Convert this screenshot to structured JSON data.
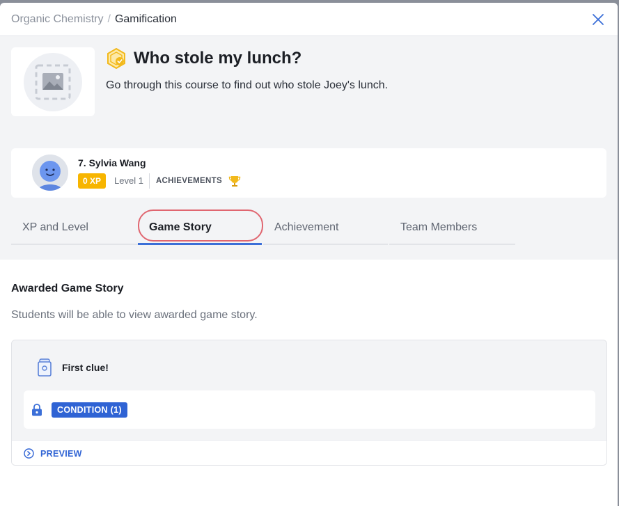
{
  "breadcrumb": {
    "parent": "Organic Chemistry",
    "separator": "/",
    "current": "Gamification"
  },
  "course": {
    "title": "Who stole my lunch?",
    "description": "Go through this course to find out who stole Joey's lunch."
  },
  "student": {
    "name": "7. Sylvia Wang",
    "xp": "0 XP",
    "level": "Level 1",
    "achievements_label": "ACHIEVEMENTS"
  },
  "tabs": [
    {
      "label": "XP and Level"
    },
    {
      "label": "Game Story"
    },
    {
      "label": "Achievement"
    },
    {
      "label": "Team Members"
    }
  ],
  "active_tab": "Game Story",
  "section": {
    "title": "Awarded Game Story",
    "description": "Students will be able to view awarded game story."
  },
  "story": {
    "name": "First clue!",
    "condition_label": "CONDITION (1)",
    "preview_label": "PREVIEW"
  },
  "colors": {
    "accent": "#2f63d4",
    "xp_badge": "#f7b500",
    "highlight": "#e06670",
    "tab_underline": "#3b6fd8"
  },
  "icons": [
    "close-icon",
    "image-placeholder-icon",
    "course-badge-icon",
    "avatar-icon",
    "trophy-icon",
    "card-icon",
    "lock-icon",
    "preview-chevron-icon"
  ]
}
